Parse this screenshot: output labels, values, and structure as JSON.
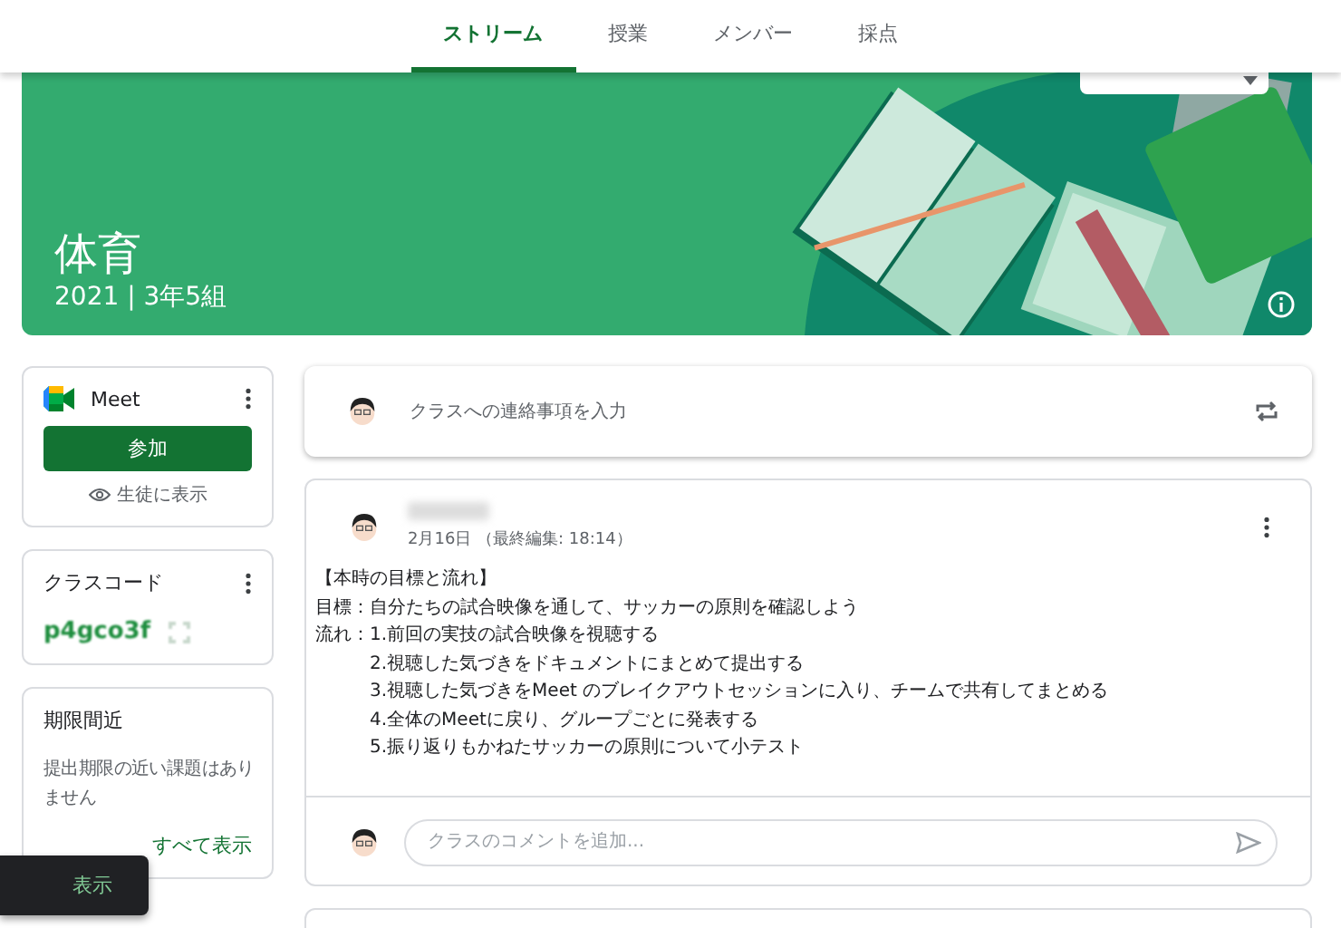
{
  "tabs": [
    {
      "label": "ストリーム",
      "selected": true
    },
    {
      "label": "授業",
      "selected": false
    },
    {
      "label": "メンバー",
      "selected": false
    },
    {
      "label": "採点",
      "selected": false
    }
  ],
  "banner": {
    "title": "体育",
    "subtitle": "2021 | 3年5組"
  },
  "meet": {
    "title": "Meet",
    "join_button": "参加",
    "visibility_link": "生徒に表示"
  },
  "class_code": {
    "title": "クラスコード",
    "code": "p4gco3f"
  },
  "upcoming": {
    "title": "期限間近",
    "message": "提出期限の近い課題はありません",
    "view_all": "すべて表示"
  },
  "announce": {
    "placeholder": "クラスへの連絡事項を入力"
  },
  "post": {
    "date": "2月16日 （最終編集: 18:14）",
    "lines": [
      {
        "kind": "plain",
        "text": "【本時の目標と流れ】"
      },
      {
        "kind": "plain",
        "text": "目標：自分たちの試合映像を通して、サッカーの原則を確認しよう"
      },
      {
        "kind": "labeled",
        "label": "流れ：",
        "text": "1.前回の実技の試合映像を視聴する"
      },
      {
        "kind": "indented",
        "text": "2.視聴した気づきをドキュメントにまとめて提出する"
      },
      {
        "kind": "indented",
        "text": "3.視聴した気づきをMeet のブレイクアウトセッションに入り、チームで共有してまとめる"
      },
      {
        "kind": "indented",
        "text": "4.全体のMeetに戻り、グループごとに発表する"
      },
      {
        "kind": "indented",
        "text": "5.振り返りもかねたサッカーの原則について小テスト"
      }
    ],
    "comment_placeholder": "クラスのコメントを追加..."
  },
  "snackbar": {
    "action": "表示"
  }
}
